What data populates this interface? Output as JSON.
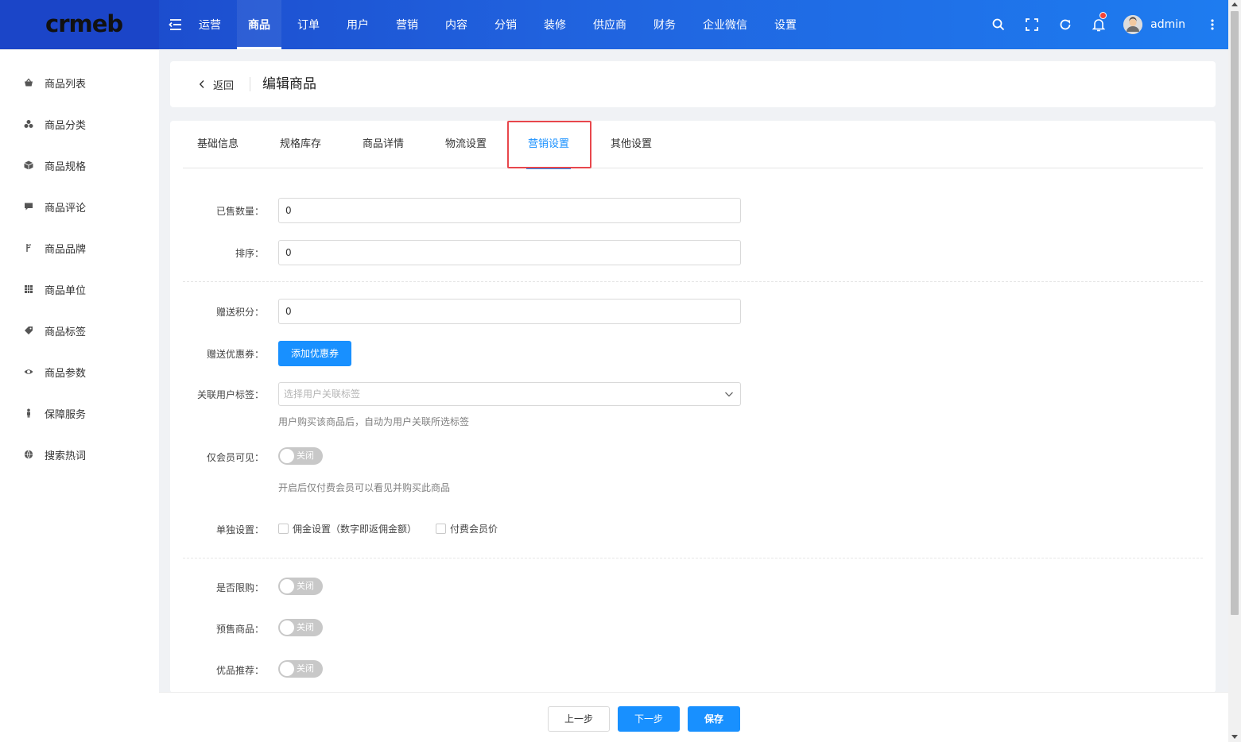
{
  "header": {
    "logo": "crmeb",
    "nav": [
      "运营",
      "商品",
      "订单",
      "用户",
      "营销",
      "内容",
      "分销",
      "装修",
      "供应商",
      "财务",
      "企业微信",
      "设置"
    ],
    "active_nav_index": 1,
    "user_name": "admin",
    "notification_has_badge": true
  },
  "sidebar": {
    "items": [
      {
        "label": "商品列表",
        "icon": "basket-icon"
      },
      {
        "label": "商品分类",
        "icon": "category-icon"
      },
      {
        "label": "商品规格",
        "icon": "cube-icon"
      },
      {
        "label": "商品评论",
        "icon": "comment-icon"
      },
      {
        "label": "商品品牌",
        "icon": "brand-icon"
      },
      {
        "label": "商品单位",
        "icon": "grid-icon"
      },
      {
        "label": "商品标签",
        "icon": "tag-icon"
      },
      {
        "label": "商品参数",
        "icon": "eye-icon"
      },
      {
        "label": "保障服务",
        "icon": "person-icon"
      },
      {
        "label": "搜索热词",
        "icon": "globe-icon"
      }
    ]
  },
  "breadcrumb": {
    "back_label": "返回",
    "title": "编辑商品"
  },
  "tabs": [
    "基础信息",
    "规格库存",
    "商品详情",
    "物流设置",
    "营销设置",
    "其他设置"
  ],
  "active_tab_index": 4,
  "form": {
    "sold_count": {
      "label": "已售数量：",
      "value": "0"
    },
    "sort": {
      "label": "排序：",
      "value": "0"
    },
    "gift_points": {
      "label": "赠送积分：",
      "value": "0"
    },
    "gift_coupon": {
      "label": "赠送优惠券：",
      "button": "添加优惠券"
    },
    "user_tags": {
      "label": "关联用户标签：",
      "placeholder": "选择用户关联标签",
      "hint": "用户购买该商品后，自动为用户关联所选标签"
    },
    "member_only": {
      "label": "仅会员可见：",
      "state": "关闭",
      "hint": "开启后仅付费会员可以看见并购买此商品"
    },
    "separate": {
      "label": "单独设置：",
      "options": [
        "佣金设置（数字即返佣金额）",
        "付费会员价"
      ]
    },
    "purchase_limit": {
      "label": "是否限购：",
      "state": "关闭"
    },
    "presale": {
      "label": "预售商品：",
      "state": "关闭"
    },
    "recommend": {
      "label": "优品推荐：",
      "state": "关闭"
    }
  },
  "footer": {
    "prev": "上一步",
    "next": "下一步",
    "save": "保存"
  },
  "colors": {
    "primary": "#1890ff",
    "header_from": "#1b45c8",
    "header_to": "#1e7cf0",
    "highlight": "#e8474c"
  }
}
